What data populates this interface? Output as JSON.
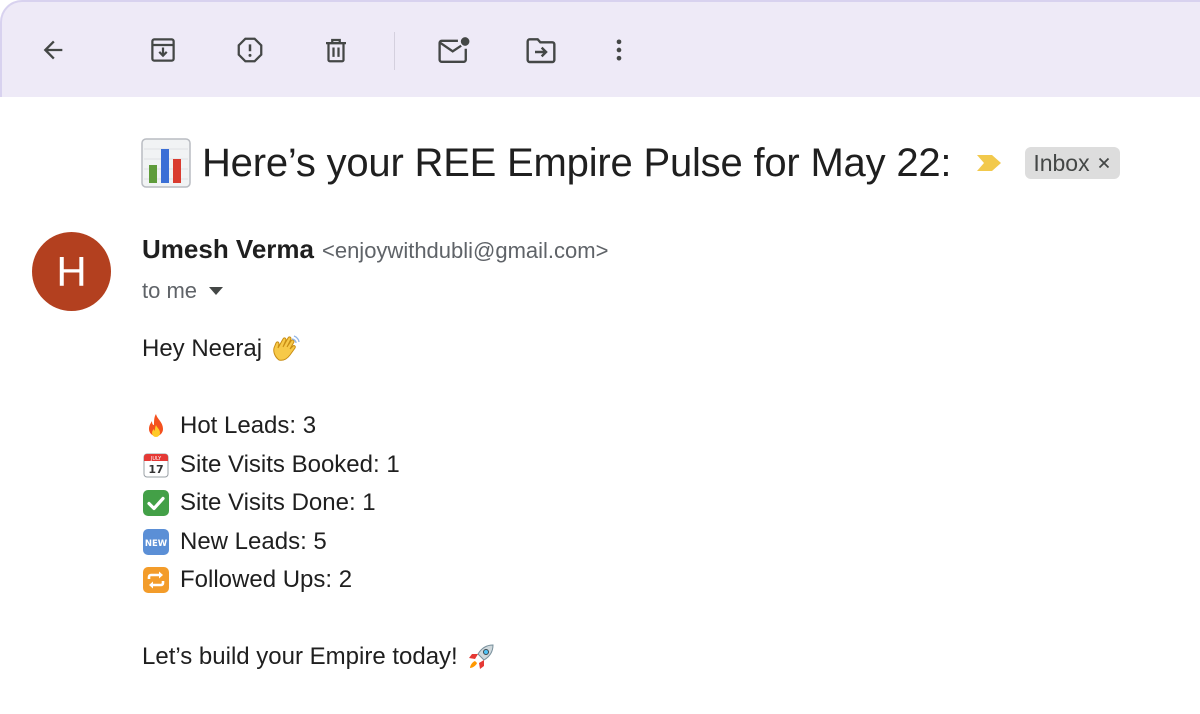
{
  "toolbar": {
    "back_icon": "arrow-back-icon",
    "archive_icon": "archive-icon",
    "report_spam_icon": "report-spam-icon",
    "delete_icon": "delete-icon",
    "mark_unread_icon": "mark-unread-icon",
    "move_to_icon": "move-to-icon",
    "more_icon": "more-vert-icon"
  },
  "email": {
    "subject": "Here’s your REE Empire Pulse for May 22:",
    "subject_emoji": "bar-chart-emoji",
    "label": "Inbox",
    "sender": {
      "avatar_letter": "H",
      "avatar_color": "#b3401f",
      "name": "Umesh Verma",
      "email": "<enjoywithdubli@gmail.com>"
    },
    "recipient_text": "to me",
    "body": {
      "greeting": "Hey Neeraj",
      "stats": [
        {
          "icon": "fire-emoji",
          "text": "Hot Leads: 3"
        },
        {
          "icon": "calendar-emoji",
          "text": "Site Visits Booked: 1"
        },
        {
          "icon": "check-mark-emoji",
          "text": "Site Visits Done: 1"
        },
        {
          "icon": "new-button-emoji",
          "text": "New Leads: 5"
        },
        {
          "icon": "repeat-emoji",
          "text": "Followed Ups: 2"
        }
      ],
      "closing": "Let’s build your Empire today!"
    }
  },
  "colors": {
    "toolbar_bg": "#eeeaf7",
    "importance_marker": "#f2c94c",
    "label_bg": "#dddddd"
  }
}
